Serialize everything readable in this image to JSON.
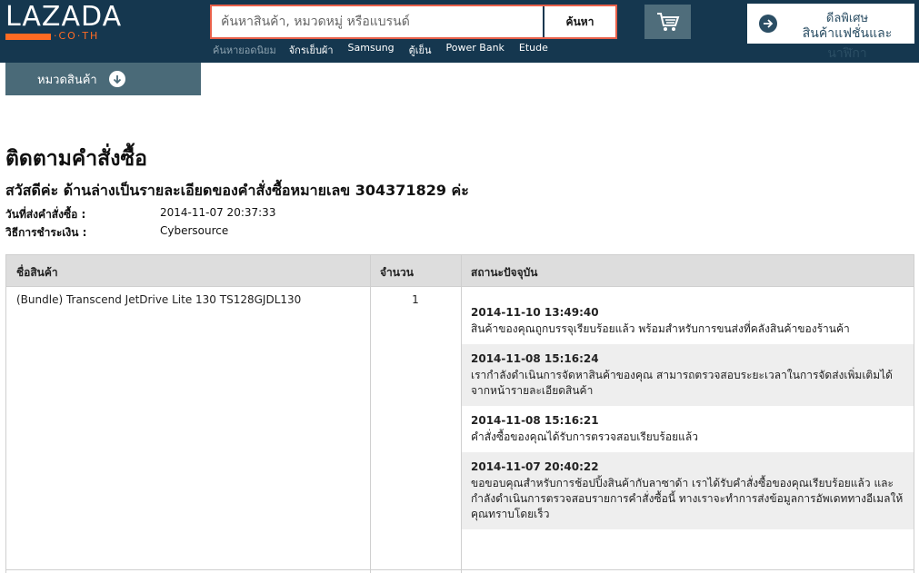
{
  "header": {
    "logo_word": "LAZADA",
    "logo_sub": "·CO·TH",
    "search": {
      "placeholder": "ค้นหาสินค้า, หมวดหมู่ หรือแบรนด์",
      "button_label": "ค้นหา"
    },
    "cart_icon": "cart-icon",
    "promo": {
      "icon": "arrow-right-circle-icon",
      "line1": "ดีลพิเศษ",
      "line2": "สินค้าแฟชั่นและนาฬิกา"
    },
    "popular": {
      "label": "ค้นหายอดนิยม",
      "items": [
        "จักรเย็บผ้า",
        "Samsung",
        "ตู้เย็น",
        "Power Bank",
        "Etude"
      ]
    }
  },
  "category": {
    "label": "หมวดสินค้า",
    "icon": "arrow-down-circle-icon"
  },
  "page": {
    "title": "ติดตามคำสั่งซื้อ",
    "greeting": "สวัสดีค่ะ ด้านล่างเป็นรายละเอียดของคำสั่งซื้อหมายเลข 304371829 ค่ะ",
    "order_date_label": "วันที่ส่งคำสั่งซื้อ :",
    "order_date_value": "2014-11-07 20:37:33",
    "payment_label": "วิธีการชำระเงิน :",
    "payment_value": "Cybersource"
  },
  "table": {
    "columns": [
      "ชื่อสินค้า",
      "จำนวน",
      "สถานะปัจจุบัน"
    ],
    "product": "(Bundle) Transcend JetDrive Lite 130 TS128GJDL130",
    "quantity": "1",
    "statuses": [
      {
        "time": "2014-11-10 13:49:40",
        "text": "สินค้าของคุณถูกบรรจุเรียบร้อยแล้ว พร้อมสำหรับการขนส่งที่คลังสินค้าของร้านค้า"
      },
      {
        "time": "2014-11-08 15:16:24",
        "text": "เรากำลังดำเนินการจัดหาสินค้าของคุณ สามารถตรวจสอบระยะเวลาในการจัดส่งเพิ่มเติมได้จากหน้ารายละเอียดสินค้า"
      },
      {
        "time": "2014-11-08 15:16:21",
        "text": "คำสั่งซื้อของคุณได้รับการตรวจสอบเรียบร้อยแล้ว"
      },
      {
        "time": "2014-11-07 20:40:22",
        "text": "ขอขอบคุณสำหรับการช้อปปิ้งสินค้ากับลาซาด้า เราได้รับคำสั่งซื้อของคุณเรียบร้อยแล้ว และกำลังดำเนินการตรวจสอบรายการคำสั่งซื้อนี้ ทางเราจะทำการส่งข้อมูลการอัพเดททางอีเมลให้คุณทราบโดยเร็ว"
      }
    ]
  },
  "colors": {
    "header_bg": "#15374f",
    "accent": "#ff6b23",
    "category_bg": "#4a6a78",
    "cart_bg": "#4f6d7b"
  }
}
